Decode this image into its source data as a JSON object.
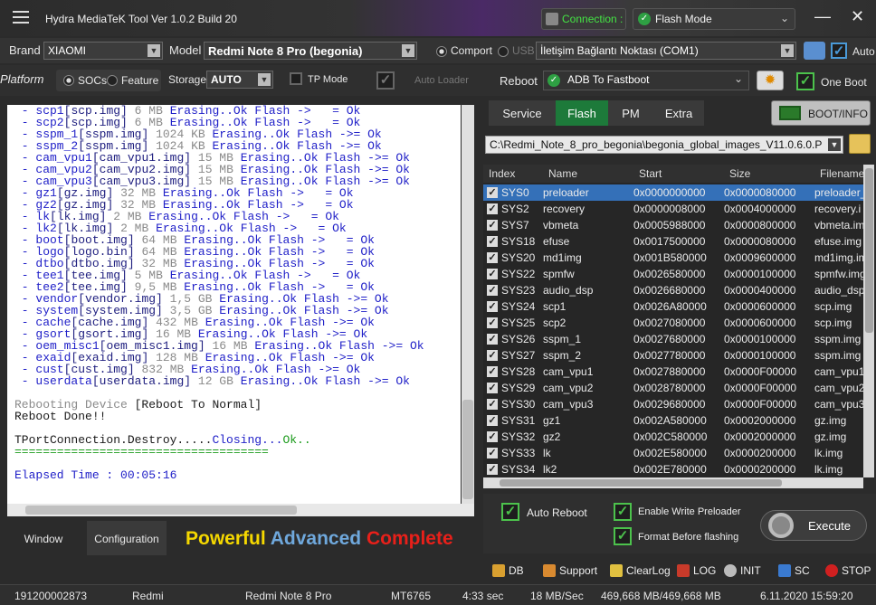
{
  "titlebar": {
    "title": "Hydra MediaTeK Tool  Ver 1.0.2 Build 20",
    "connection_label": "Connection :",
    "mode_value": "Flash Mode"
  },
  "config": {
    "brand_label": "Brand",
    "brand_value": "XIAOMI",
    "model_label": "Model",
    "model_value": "Redmi Note 8 Pro (begonia)",
    "comport_label": "Comport",
    "usb_label": "USB",
    "port_value": "İletişim Bağlantı Noktası (COM1)",
    "auto_label": "Auto",
    "platform_label": "Platform",
    "socs_label": "SOCs",
    "feature_label": "Feature",
    "storage_label": "Storage",
    "storage_value": "AUTO",
    "tp_mode_label": "TP Mode",
    "auto_loader_label": "Auto Loader",
    "reboot_label": "Reboot",
    "reboot_value": "ADB To Fastboot",
    "one_boot_label": "One Boot"
  },
  "log": {
    "lines": [
      {
        "part": "scp1",
        "file": "scp.img",
        "size": "6 MB",
        "result": "Erasing..Ok Flash ->   = Ok"
      },
      {
        "part": "scp2",
        "file": "scp.img",
        "size": "6 MB",
        "result": "Erasing..Ok Flash ->   = Ok"
      },
      {
        "part": "sspm_1",
        "file": "sspm.img",
        "size": "1024 KB",
        "result": "Erasing..Ok Flash ->= Ok"
      },
      {
        "part": "sspm_2",
        "file": "sspm.img",
        "size": "1024 KB",
        "result": "Erasing..Ok Flash ->= Ok"
      },
      {
        "part": "cam_vpu1",
        "file": "cam_vpu1.img",
        "size": "15 MB",
        "result": "Erasing..Ok Flash ->= Ok"
      },
      {
        "part": "cam_vpu2",
        "file": "cam_vpu2.img",
        "size": "15 MB",
        "result": "Erasing..Ok Flash ->= Ok"
      },
      {
        "part": "cam_vpu3",
        "file": "cam_vpu3.img",
        "size": "15 MB",
        "result": "Erasing..Ok Flash ->= Ok"
      },
      {
        "part": "gz1",
        "file": "gz.img",
        "size": "32 MB",
        "result": "Erasing..Ok Flash ->   = Ok"
      },
      {
        "part": "gz2",
        "file": "gz.img",
        "size": "32 MB",
        "result": "Erasing..Ok Flash ->   = Ok"
      },
      {
        "part": "lk",
        "file": "lk.img",
        "size": "2 MB",
        "result": "Erasing..Ok Flash ->   = Ok"
      },
      {
        "part": "lk2",
        "file": "lk.img",
        "size": "2 MB",
        "result": "Erasing..Ok Flash ->   = Ok"
      },
      {
        "part": "boot",
        "file": "boot.img",
        "size": "64 MB",
        "result": "Erasing..Ok Flash ->   = Ok"
      },
      {
        "part": "logo",
        "file": "logo.bin",
        "size": "64 MB",
        "result": "Erasing..Ok Flash ->   = Ok"
      },
      {
        "part": "dtbo",
        "file": "dtbo.img",
        "size": "32 MB",
        "result": "Erasing..Ok Flash ->   = Ok"
      },
      {
        "part": "tee1",
        "file": "tee.img",
        "size": "5 MB",
        "result": "Erasing..Ok Flash ->   = Ok"
      },
      {
        "part": "tee2",
        "file": "tee.img",
        "size": "9,5 MB",
        "result": "Erasing..Ok Flash ->   = Ok"
      },
      {
        "part": "vendor",
        "file": "vendor.img",
        "size": "1,5 GB",
        "result": "Erasing..Ok Flash ->= Ok"
      },
      {
        "part": "system",
        "file": "system.img",
        "size": "3,5 GB",
        "result": "Erasing..Ok Flash ->= Ok"
      },
      {
        "part": "cache",
        "file": "cache.img",
        "size": "432 MB",
        "result": "Erasing..Ok Flash ->= Ok"
      },
      {
        "part": "gsort",
        "file": "gsort.img",
        "size": "16 MB",
        "result": "Erasing..Ok Flash ->= Ok"
      },
      {
        "part": "oem_misc1",
        "file": "oem_misc1.img",
        "size": "16 MB",
        "result": "Erasing..Ok Flash ->= Ok"
      },
      {
        "part": "exaid",
        "file": "exaid.img",
        "size": "128 MB",
        "result": "Erasing..Ok Flash ->= Ok"
      },
      {
        "part": "cust",
        "file": "cust.img",
        "size": "832 MB",
        "result": "Erasing..Ok Flash ->= Ok"
      },
      {
        "part": "userdata",
        "file": "userdata.img",
        "size": "12 GB",
        "result": "Erasing..Ok Flash ->= Ok"
      }
    ],
    "reboot_prefix": "Rebooting Device ",
    "reboot_target": "[Reboot To Normal]",
    "reboot_done": "Reboot Done!!",
    "destroy_prefix": "TPortConnection.Destroy.....",
    "destroy_closing": "Closing...",
    "destroy_ok": "Ok..",
    "separator": "====================================",
    "elapsed": "Elapsed Time : 00:05:16"
  },
  "left_tabs": {
    "window": "Window",
    "configuration": "Configuration"
  },
  "slogan": {
    "w1": "Powerful",
    "w2": "Advanced",
    "w3": "Complete"
  },
  "tabs": {
    "service": "Service",
    "flash": "Flash",
    "pm": "PM",
    "extra": "Extra",
    "bootinfo": "BOOT/INFO"
  },
  "path": "C:\\Redmi_Note_8_pro_begonia\\begonia_global_images_V11.0.6.0.P",
  "grid": {
    "headers": {
      "index": "Index",
      "name": "Name",
      "start": "Start",
      "size": "Size",
      "filename": "Filename"
    },
    "rows": [
      {
        "index": "SYS0",
        "name": "preloader",
        "start": "0x0000000000",
        "size": "0x0000080000",
        "filename": "preloader_"
      },
      {
        "index": "SYS2",
        "name": "recovery",
        "start": "0x0000008000",
        "size": "0x0004000000",
        "filename": "recovery.i"
      },
      {
        "index": "SYS7",
        "name": "vbmeta",
        "start": "0x0005988000",
        "size": "0x0000800000",
        "filename": "vbmeta.im"
      },
      {
        "index": "SYS18",
        "name": "efuse",
        "start": "0x0017500000",
        "size": "0x0000080000",
        "filename": "efuse.img"
      },
      {
        "index": "SYS20",
        "name": "md1img",
        "start": "0x001B580000",
        "size": "0x0009600000",
        "filename": "md1img.im"
      },
      {
        "index": "SYS22",
        "name": "spmfw",
        "start": "0x0026580000",
        "size": "0x0000100000",
        "filename": "spmfw.img"
      },
      {
        "index": "SYS23",
        "name": "audio_dsp",
        "start": "0x0026680000",
        "size": "0x0000400000",
        "filename": "audio_dsp"
      },
      {
        "index": "SYS24",
        "name": "scp1",
        "start": "0x0026A80000",
        "size": "0x0000600000",
        "filename": "scp.img"
      },
      {
        "index": "SYS25",
        "name": "scp2",
        "start": "0x0027080000",
        "size": "0x0000600000",
        "filename": "scp.img"
      },
      {
        "index": "SYS26",
        "name": "sspm_1",
        "start": "0x0027680000",
        "size": "0x0000100000",
        "filename": "sspm.img"
      },
      {
        "index": "SYS27",
        "name": "sspm_2",
        "start": "0x0027780000",
        "size": "0x0000100000",
        "filename": "sspm.img"
      },
      {
        "index": "SYS28",
        "name": "cam_vpu1",
        "start": "0x0027880000",
        "size": "0x0000F00000",
        "filename": "cam_vpu1"
      },
      {
        "index": "SYS29",
        "name": "cam_vpu2",
        "start": "0x0028780000",
        "size": "0x0000F00000",
        "filename": "cam_vpu2"
      },
      {
        "index": "SYS30",
        "name": "cam_vpu3",
        "start": "0x0029680000",
        "size": "0x0000F00000",
        "filename": "cam_vpu3"
      },
      {
        "index": "SYS31",
        "name": "gz1",
        "start": "0x002A580000",
        "size": "0x0002000000",
        "filename": "gz.img"
      },
      {
        "index": "SYS32",
        "name": "gz2",
        "start": "0x002C580000",
        "size": "0x0002000000",
        "filename": "gz.img"
      },
      {
        "index": "SYS33",
        "name": "lk",
        "start": "0x002E580000",
        "size": "0x0000200000",
        "filename": "lk.img"
      },
      {
        "index": "SYS34",
        "name": "lk2",
        "start": "0x002E780000",
        "size": "0x0000200000",
        "filename": "lk.img"
      }
    ]
  },
  "options": {
    "auto_reboot": "Auto Reboot",
    "enable_write_preloader": "Enable Write Preloader",
    "format_before_flashing": "Format Before flashing",
    "execute": "Execute"
  },
  "actions": {
    "db": "DB",
    "support": "Support",
    "clearlog": "ClearLog",
    "log": "LOG",
    "init": "INIT",
    "sc": "SC",
    "stop": "STOP"
  },
  "status": {
    "serial": "191200002873",
    "brand": "Redmi",
    "model": "Redmi Note 8 Pro",
    "chip": "MT6765",
    "time": "4:33 sec",
    "speed": "18 MB/Sec",
    "bytes": "469,668 MB/469,668 MB",
    "datetime": "6.11.2020 15:59:20"
  },
  "colors": {
    "accent_green": "#1d7a3a",
    "selected_row": "#3470b8",
    "slogan_powerful": "#f5d800",
    "slogan_advanced": "#6fa8dc",
    "slogan_complete": "#e8201a"
  }
}
